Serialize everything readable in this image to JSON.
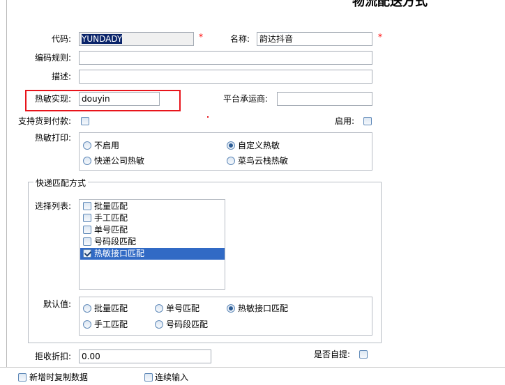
{
  "page": {
    "title": "物流配送方式"
  },
  "form": {
    "code_label": "代码:",
    "code_value": "YUNDADY",
    "name_label": "名称:",
    "name_value": "韵达抖音",
    "required_mark": "*",
    "coding_rule_label": "编码规则:",
    "coding_rule_value": "",
    "description_label": "描述:",
    "description_value": "",
    "thermal_impl_label": "热敏实现:",
    "thermal_impl_value": "douyin",
    "platform_carrier_label": "平台承运商:",
    "platform_carrier_value": "",
    "cod_label": "支持货到付款:",
    "cod_checked": false,
    "enable_label": "启用:",
    "enable_checked": false,
    "thermal_print_label": "热敏打印:",
    "thermal_print_options": [
      {
        "label": "不启用",
        "selected": false
      },
      {
        "label": "自定义热敏",
        "selected": true
      },
      {
        "label": "快递公司热敏",
        "selected": false
      },
      {
        "label": "菜鸟云栈热敏",
        "selected": false
      }
    ]
  },
  "match_group": {
    "legend": "快递匹配方式",
    "select_list_label": "选择列表:",
    "list_items": [
      {
        "label": "批量匹配",
        "checked": false,
        "active": false
      },
      {
        "label": "手工匹配",
        "checked": false,
        "active": false
      },
      {
        "label": "单号匹配",
        "checked": false,
        "active": false
      },
      {
        "label": "号码段匹配",
        "checked": false,
        "active": false
      },
      {
        "label": "热敏接口匹配",
        "checked": true,
        "active": true
      }
    ],
    "default_label": "默认值:",
    "default_options": [
      {
        "label": "批量匹配",
        "selected": false
      },
      {
        "label": "单号匹配",
        "selected": false
      },
      {
        "label": "热敏接口匹配",
        "selected": true
      },
      {
        "label": "手工匹配",
        "selected": false
      },
      {
        "label": "号码段匹配",
        "selected": false
      }
    ]
  },
  "footer_fields": {
    "refuse_discount_label": "拒收折扣:",
    "refuse_discount_value": "0.00",
    "self_pickup_label": "是否自提:",
    "self_pickup_checked": false
  },
  "bottom_bar": {
    "copy_on_add_label": "新增时复制数据",
    "copy_on_add_checked": false,
    "continuous_input_label": "连续输入",
    "continuous_input_checked": false
  },
  "colors": {
    "highlight": "#e8141b",
    "selection": "#316ac5",
    "required": "#ff0000"
  }
}
